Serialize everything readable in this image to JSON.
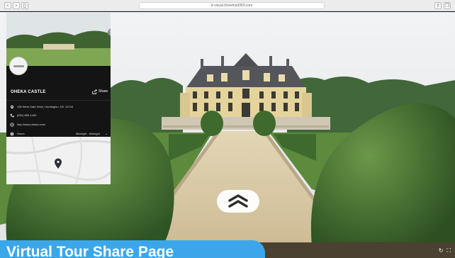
{
  "browser": {
    "url": "d-visual.threehold360.com",
    "reload_glyph": "↻",
    "nav_icons": [
      "back-arrow-icon",
      "forward-arrow-icon",
      "sidebar-icon"
    ],
    "right_icons": [
      "share-icon",
      "tabs-icon"
    ]
  },
  "panel": {
    "close_glyph": "×",
    "place_name": "OHEKA CASTLE",
    "share_label": "Share",
    "address": "135 West Gate Drive, Huntington, NY, 11743",
    "phone": "(631) 659-1400",
    "website": "http://www.oheka.com/",
    "hours_label": "Hours",
    "hours_value": "Midnight - Midnight",
    "hours_chevron": "⌄"
  },
  "banner": {
    "text": "Virtual Tour Share Page"
  },
  "controls": {
    "rotate_glyph": "↻",
    "fullscreen_glyph": "⛶"
  },
  "colors": {
    "banner": "#3ba7ea",
    "panel_bg": "#141414",
    "facade": "#e4d49c",
    "roof": "#55555c",
    "gravel": "#d8c9a6",
    "hedge": "#4f7d3a",
    "sky": "#e9ecee"
  }
}
